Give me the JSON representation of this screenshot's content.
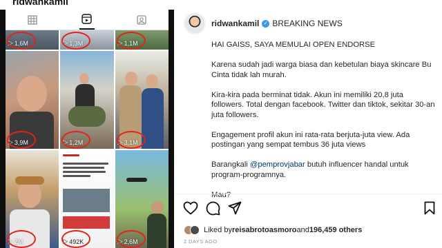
{
  "profile": {
    "username": "ridwankamil"
  },
  "grid": {
    "tiles": [
      {
        "views": "1,6M"
      },
      {
        "views": "1,3M"
      },
      {
        "views": "1,1M"
      },
      {
        "views": "3,9M"
      },
      {
        "views": "1,2M"
      },
      {
        "views": "3,1M"
      },
      {
        "views": "2M"
      },
      {
        "views": "492K"
      },
      {
        "views": "2,6M"
      }
    ]
  },
  "post": {
    "username": "ridwankamil",
    "header_caption": "BREAKING NEWS",
    "paragraphs": [
      "HAI GAISS, SAYA MEMULAI OPEN ENDORSE",
      "Karena sudah jadi warga biasa dan kebetulan biaya skincare Bu Cinta tidak lah murah.",
      "Kira-kira pada berminat tidak. Akun ini memiliki 20,8 juta followers. Total dengan facebook. Twitter dan tiktok, sekitar 30-an juta followers.",
      "Engagement profil akun ini rata-rata berjuta-juta view. Ada postingan yang sempat tembus 36 juta views"
    ],
    "last_para": {
      "before": "Barangkali ",
      "mention": "@pemprovjabar",
      "after": " butuh influencer handal untuk program-programnya."
    },
    "closing": "Mau?",
    "likes": {
      "prefix": "Liked by ",
      "user": "reisabrotoasmoro",
      "middle": " and ",
      "count": "196,459 others"
    },
    "timestamp": "2 DAYS AGO"
  },
  "icons": {
    "grid": "grid-icon",
    "reels": "reels-icon",
    "tagged": "tagged-icon",
    "like": "heart-icon",
    "comment": "comment-icon",
    "share": "share-icon",
    "save": "bookmark-icon"
  },
  "colors": {
    "annotation_circle": "#e0241b",
    "verified": "#3897f0",
    "mention": "#00376b"
  }
}
